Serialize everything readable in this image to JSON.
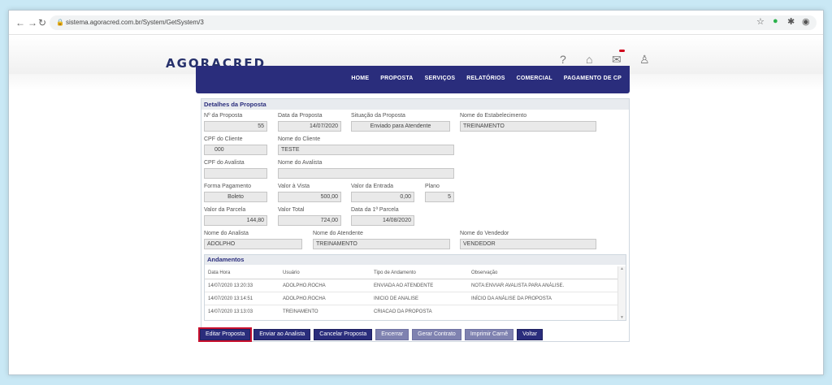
{
  "browser": {
    "url": "sistema.agoracred.com.br/System/GetSystem/3"
  },
  "header": {
    "logo": "AGORACRED"
  },
  "nav": {
    "items": [
      "HOME",
      "PROPOSTA",
      "SERVIÇOS",
      "RELATÓRIOS",
      "COMERCIAL",
      "PAGAMENTO DE CP"
    ]
  },
  "details": {
    "title": "Detalhes da Proposta",
    "numero_label": "Nº da Proposta",
    "numero_value": "55",
    "data_label": "Data da Proposta",
    "data_value": "14/07/2020",
    "situacao_label": "Situação da Proposta",
    "situacao_value": "Enviado para Atendente",
    "estab_label": "Nome do Estabelecimento",
    "estab_value": "TREINAMENTO",
    "cpf_label": "CPF do Cliente",
    "cpf_value": "000",
    "cliente_label": "Nome do Cliente",
    "cliente_value": "TESTE",
    "cpf_aval_label": "CPF do Avalista",
    "cpf_aval_value": "",
    "aval_label": "Nome do Avalista",
    "aval_value": "",
    "forma_label": "Forma Pagamento",
    "forma_value": "Boleto",
    "vista_label": "Valor à Vista",
    "vista_value": "500,00",
    "entrada_label": "Valor da Entrada",
    "entrada_value": "0,00",
    "plano_label": "Plano",
    "plano_value": "5",
    "parcela_label": "Valor da Parcela",
    "parcela_value": "144,80",
    "total_label": "Valor Total",
    "total_value": "724,00",
    "data1_label": "Data da 1ª Parcela",
    "data1_value": "14/08/2020",
    "analista_label": "Nome do Analista",
    "analista_value": "ADOLPHO",
    "atendente_label": "Nome do Atendente",
    "atendente_value": "TREINAMENTO",
    "vendedor_label": "Nome do Vendedor",
    "vendedor_value": "VENDEDOR"
  },
  "andamentos": {
    "title": "Andamentos",
    "headers": [
      "Data Hora",
      "Usuário",
      "Tipo de Andamento",
      "Observação"
    ],
    "rows": [
      [
        "14/07/2020 13:20:33",
        "ADOLPHO.ROCHA",
        "ENVIADA AO ATENDENTE",
        "NOTA:ENVIAR AVALISTA PARA ANÁLISE."
      ],
      [
        "14/07/2020 13:14:51",
        "ADOLPHO.ROCHA",
        "INICIO DE ANALISE",
        "INÍCIO DA ANÁLISE DA PROPOSTA"
      ],
      [
        "14/07/2020 13:13:03",
        "TREINAMENTO",
        "CRIACAO DA PROPOSTA",
        ""
      ]
    ]
  },
  "buttons": {
    "editar": "Editar Proposta",
    "enviar": "Enviar ao Analista",
    "cancelar": "Cancelar Proposta",
    "encerrar": "Encerrar",
    "gerar": "Gerar Contrato",
    "imprimir": "Imprimir Carnê",
    "voltar": "Voltar"
  },
  "colors": {
    "brand": "#2a2d7c",
    "highlight": "#c8102e"
  }
}
